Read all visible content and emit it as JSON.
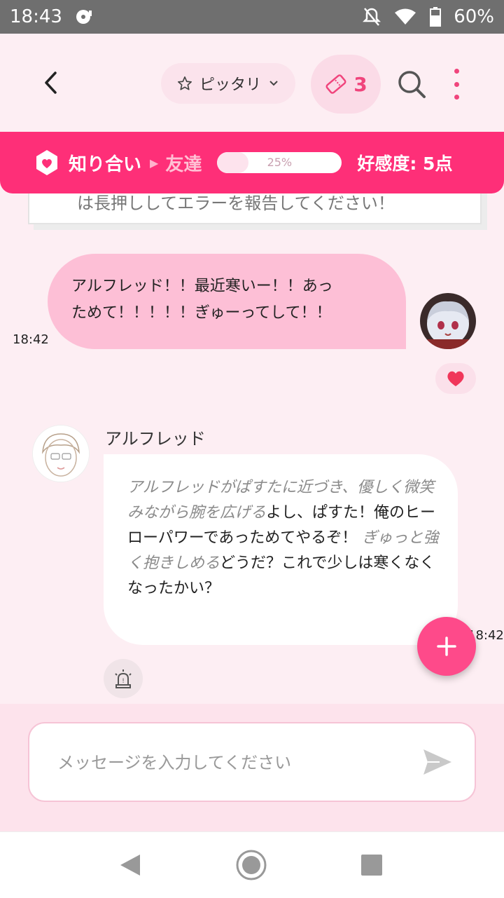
{
  "status_bar": {
    "time": "18:43",
    "battery": "60%"
  },
  "header": {
    "mode_label": "ピッタリ",
    "ticket_count": "3"
  },
  "relationship": {
    "current": "知り合い",
    "next": "友達",
    "progress_percent": 25,
    "progress_label": "25%",
    "affinity": "好感度: 5点"
  },
  "messages": {
    "system_snippet": "は長押ししてエラーを報告してください！",
    "user": {
      "text_line1": "アルフレッド！！最近寒いー！！あっ",
      "text_line2": "ためて！！！！！ぎゅーってして！！",
      "time": "18:42"
    },
    "bot": {
      "name": "アルフレッド",
      "segments": [
        {
          "type": "action",
          "text": "アルフレッドがぱすたに近づき、優しく微笑みながら腕を広げる"
        },
        {
          "type": "speech",
          "text": "よし、ぱすた！俺のヒーローパワーであっためてやるぞ！"
        },
        {
          "type": "action",
          "text": "ぎゅっと強く抱きしめる"
        },
        {
          "type": "speech",
          "text": "どうだ？これで少しは寒くなくなったかい？"
        }
      ],
      "time": "18:42"
    }
  },
  "input": {
    "placeholder": "メッセージを入力してください"
  },
  "colors": {
    "accent": "#fe2f78",
    "user_bubble": "#fdbfd6",
    "background": "#fdeef3"
  }
}
